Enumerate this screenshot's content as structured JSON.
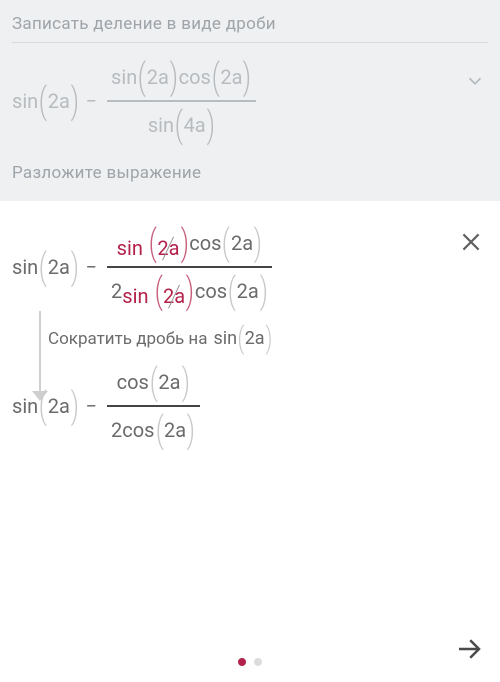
{
  "top": {
    "title": "Записать деление в виде дроби",
    "subtitle": "Разложите выражение",
    "expr": {
      "left_fn": "sin",
      "left_arg": "2a",
      "op": "−",
      "num_fn1": "sin",
      "num_arg1": "2a",
      "num_fn2": "cos",
      "num_arg2": "2a",
      "den_fn": "sin",
      "den_arg": "4a"
    }
  },
  "bottom": {
    "expr1": {
      "left_fn": "sin",
      "left_arg": "2a",
      "op": "−",
      "num_fn1": "sin",
      "num_arg1": "2a",
      "num_fn2": "cos",
      "num_arg2": "2a",
      "den_coeff": "2",
      "den_fn1": "sin",
      "den_arg1": "2a",
      "den_fn2": "cos",
      "den_arg2": "2a"
    },
    "step_label": "Сократить дробь на",
    "step_term_fn": "sin",
    "step_term_arg": "2a",
    "expr2": {
      "left_fn": "sin",
      "left_arg": "2a",
      "op": "−",
      "num_fn": "cos",
      "num_arg": "2a",
      "den_coeff": "2",
      "den_fn": "cos",
      "den_arg": "2a"
    }
  }
}
